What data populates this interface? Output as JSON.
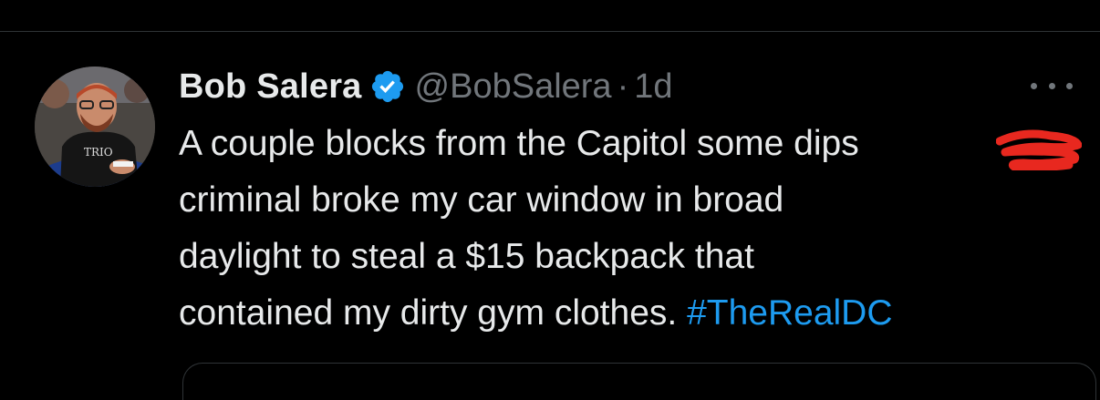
{
  "tweet": {
    "display_name": "Bob Salera",
    "handle": "@BobSalera",
    "separator": "·",
    "timestamp": "1d",
    "text_lines": [
      "A couple blocks from the Capitol some dips",
      "criminal broke my car window in broad",
      "daylight to steal a $15 backpack that",
      "contained my dirty gym clothes."
    ],
    "hashtag": "#TheRealDC",
    "verified": true
  },
  "icons": {
    "verified": "verified-badge-icon",
    "more": "more-horizontal-icon"
  },
  "colors": {
    "background": "#000000",
    "text_primary": "#e7e9ea",
    "text_secondary": "#71767b",
    "accent": "#1d9bf0",
    "redaction": "#e8281f"
  }
}
